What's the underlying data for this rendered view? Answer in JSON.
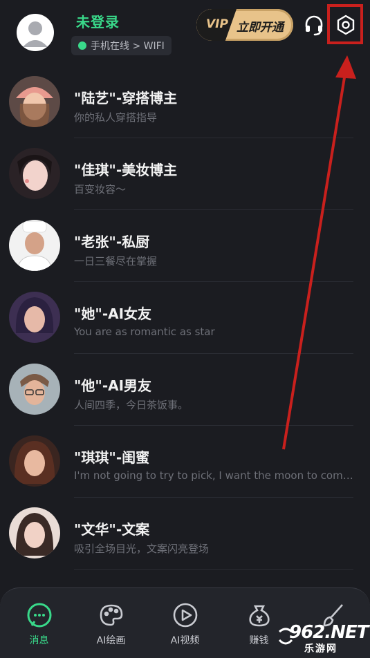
{
  "header": {
    "login_title": "未登录",
    "status_text": "手机在线 > WIFI",
    "vip_badge": "VIP",
    "vip_label": "立即开通"
  },
  "contacts": [
    {
      "name": "\"陆艺\"-穿搭博主",
      "subtitle": "你的私人穿搭指导",
      "avatar_color": "#e8b59a"
    },
    {
      "name": "\"佳琪\"-美妆博主",
      "subtitle": "百变妆容～",
      "avatar_color": "#e9c7c0"
    },
    {
      "name": "\"老张\"-私厨",
      "subtitle": "一日三餐尽在掌握",
      "avatar_color": "#c89a84"
    },
    {
      "name": "\"她\"-AI女友",
      "subtitle": "You are as romantic as star",
      "avatar_color": "#5c4a72"
    },
    {
      "name": "\"他\"-AI男友",
      "subtitle": "人间四季，今日茶饭事。",
      "avatar_color": "#b58d76"
    },
    {
      "name": "\"琪琪\"-闺蜜",
      "subtitle": "I'm not going to try to pick, I want the moon to come...",
      "avatar_color": "#7a4a3c"
    },
    {
      "name": "\"文华\"-文案",
      "subtitle": "吸引全场目光，文案闪亮登场",
      "avatar_color": "#d7b3a8"
    }
  ],
  "tabs": [
    {
      "label": "消息",
      "icon": "chat-bubble-icon"
    },
    {
      "label": "AI绘画",
      "icon": "palette-icon"
    },
    {
      "label": "AI视频",
      "icon": "play-circle-icon"
    },
    {
      "label": "赚钱",
      "icon": "money-bag-icon"
    },
    {
      "label": "",
      "icon": "brush-icon"
    }
  ],
  "watermark": {
    "number": "962.NET",
    "sub": "乐游网"
  },
  "colors": {
    "accent": "#39d98a",
    "highlight": "#c9201d",
    "vip_gold": "#e8c38a"
  }
}
